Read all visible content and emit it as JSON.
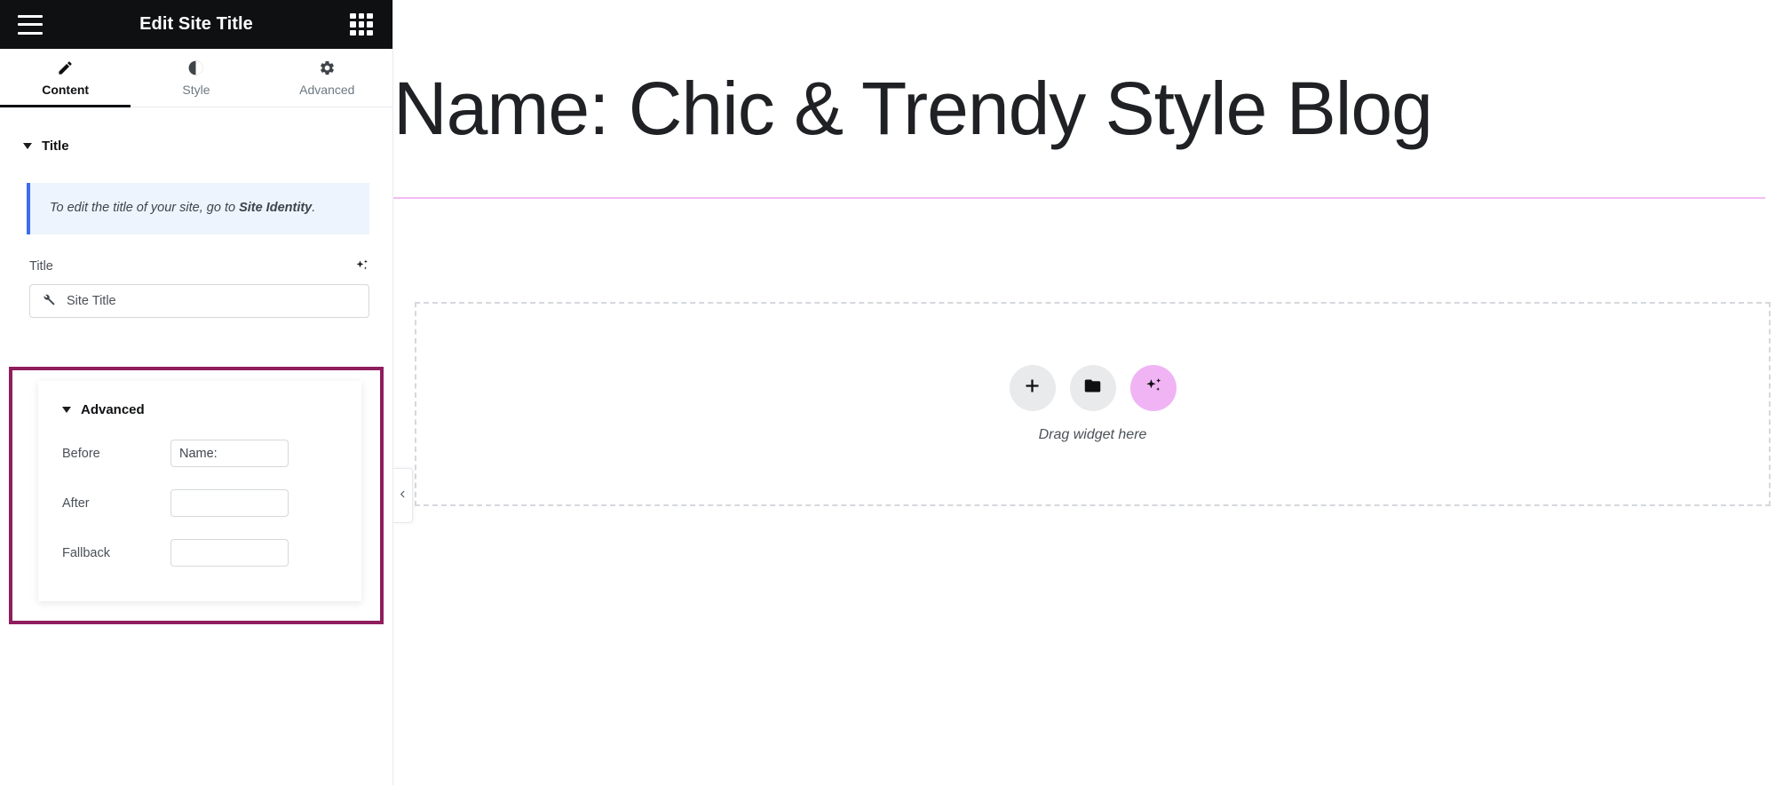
{
  "panel": {
    "header": {
      "title": "Edit Site Title",
      "menu_icon": "hamburger-menu-icon",
      "apps_icon": "app-grid-icon"
    },
    "tabs": [
      {
        "label": "Content",
        "icon": "pencil-icon",
        "active": true
      },
      {
        "label": "Style",
        "icon": "contrast-icon",
        "active": false
      },
      {
        "label": "Advanced",
        "icon": "gear-icon",
        "active": false
      }
    ],
    "sections": {
      "title_section": {
        "label": "Title",
        "collapse_icon": "caret-down-icon",
        "notice": {
          "text_before": "To edit the title of your site, go to ",
          "link_text": "Site Identity",
          "text_after": ".",
          "accent_color": "#3a6df0",
          "background": "#eef4fd"
        },
        "title_field": {
          "label": "Title",
          "ai_icon": "ai-sparkle-icon",
          "select_value": "Site Title",
          "select_icon": "wrench-icon"
        }
      },
      "advanced_section": {
        "label": "Advanced",
        "collapse_icon": "caret-down-icon",
        "highlight_color": "#8e1e5d",
        "fields": [
          {
            "label": "Before",
            "value": "Name:",
            "placeholder": ""
          },
          {
            "label": "After",
            "value": "",
            "placeholder": ""
          },
          {
            "label": "Fallback",
            "value": "",
            "placeholder": ""
          }
        ]
      }
    }
  },
  "canvas": {
    "site_title": "Name: Chic & Trendy Style Blog",
    "title_underline_color": "#f2bdf2",
    "dropzone": {
      "hint": "Drag widget here",
      "buttons": [
        {
          "icon": "plus-icon",
          "name": "add-widget-button",
          "color": "#e9eaec"
        },
        {
          "icon": "folder-icon",
          "name": "add-template-button",
          "color": "#e9eaec"
        },
        {
          "icon": "ai-sparkle-icon",
          "name": "ai-builder-button",
          "color": "#f0b4f5"
        }
      ]
    },
    "collapse_icon": "chevron-left-icon"
  }
}
